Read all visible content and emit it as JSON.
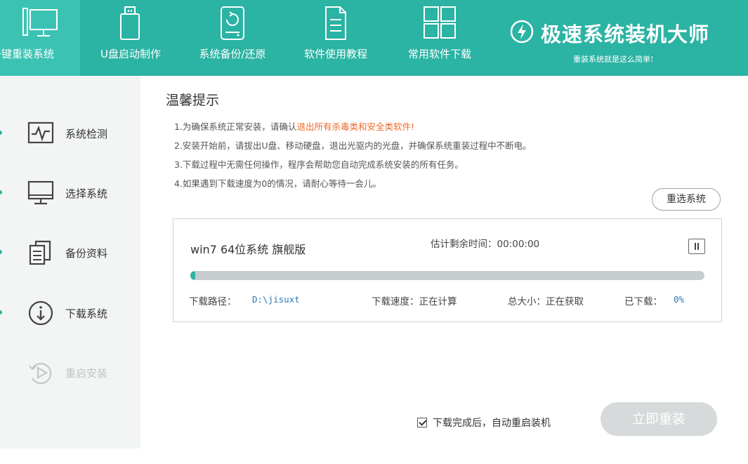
{
  "header": {
    "nav": [
      {
        "label": "一键重装系统",
        "icon": "monitor-icon"
      },
      {
        "label": "U盘启动制作",
        "icon": "usb-drive-icon"
      },
      {
        "label": "系统备份/还原",
        "icon": "backup-disk-icon"
      },
      {
        "label": "软件使用教程",
        "icon": "document-icon"
      },
      {
        "label": "常用软件下载",
        "icon": "grid-apps-icon"
      }
    ],
    "brand_title": "极速系统装机大师",
    "brand_subtitle": "重装系统就是这么简单!",
    "brand_icon": "lightning-icon"
  },
  "sidebar": {
    "steps": [
      {
        "label": "系统检测",
        "icon": "pulse-monitor-icon"
      },
      {
        "label": "选择系统",
        "icon": "desktop-icon"
      },
      {
        "label": "备份资料",
        "icon": "copy-files-icon"
      },
      {
        "label": "下载系统",
        "icon": "download-circle-icon"
      },
      {
        "label": "重启安装",
        "icon": "restart-play-icon"
      }
    ]
  },
  "tips": {
    "title": "温馨提示",
    "line1_prefix": "1.为确保系统正常安装，请确认",
    "line1_warn": "退出所有杀毒类和安全类软件!",
    "line2": "2.安装开始前，请拔出U盘、移动硬盘，退出光驱内的光盘，并确保系统重装过程中不断电。",
    "line3": "3.下载过程中无需任何操作，程序会帮助您自动完成系统安装的所有任务。",
    "line4": "4.如果遇到下载速度为0的情况，请耐心等待一会儿。"
  },
  "reselect_label": "重选系统",
  "download": {
    "name": "win7 64位系统 旗舰版",
    "eta": "估计剩余时间：00:00:00",
    "progress": 0.01,
    "path_label": "下载路径：",
    "path_value": "D:\\jisuxt",
    "speed": "下载速度：正在计算",
    "total": "总大小：正在获取",
    "downloaded_label": "已下载：",
    "downloaded_value": "0%"
  },
  "auto_reboot_label": "下载完成后，自动重启装机",
  "auto_reboot_checked": true,
  "install_label": "立即重装",
  "colors": {
    "accent": "#2bb3a3",
    "warn": "#ef6a2b",
    "disabled": "#d6dadb"
  }
}
